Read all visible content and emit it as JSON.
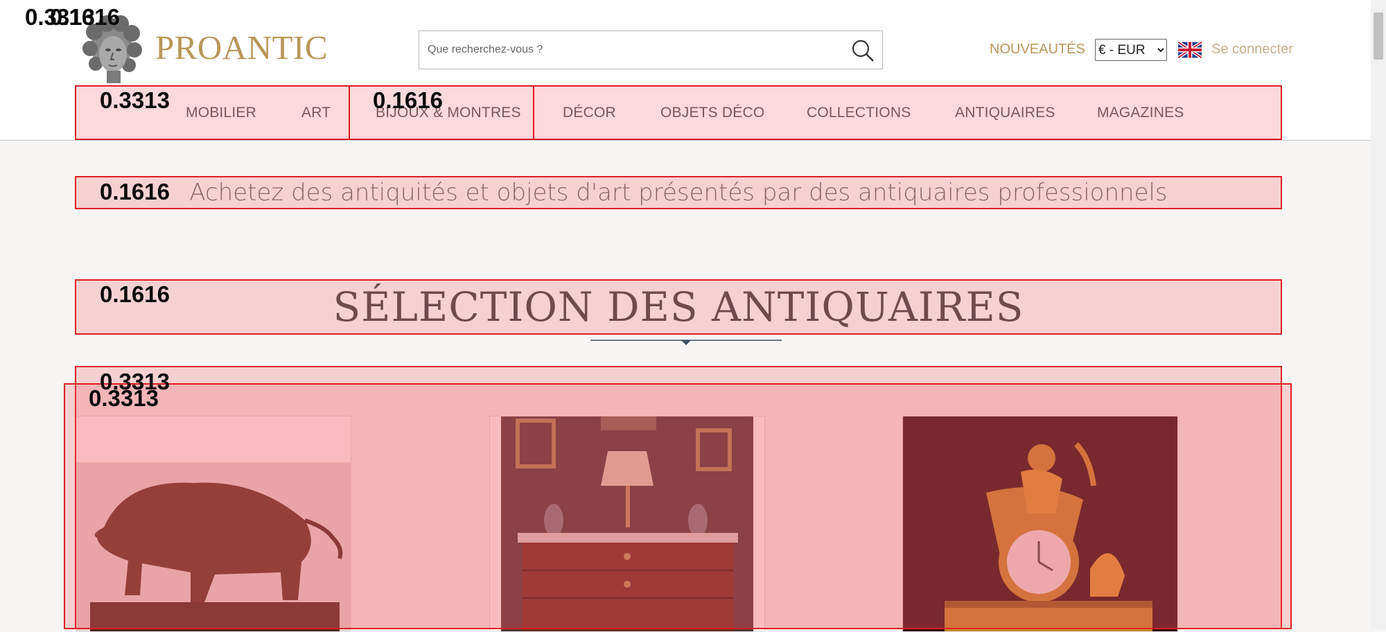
{
  "header": {
    "brand": "PROANTIC",
    "search": {
      "placeholder": "Que recherchez-vous ?",
      "value": ""
    },
    "nouveautes_label": "NOUVEAUTÉS",
    "currency": {
      "selected": "€ - EUR",
      "options": [
        "€ - EUR"
      ]
    },
    "flag_icon": "uk-flag-icon",
    "login_label": "Se connecter"
  },
  "nav": {
    "items": [
      {
        "label": "MOBILIER"
      },
      {
        "label": "ART"
      },
      {
        "label": "BIJOUX & MONTRES"
      },
      {
        "label": "DÉCOR"
      },
      {
        "label": "OBJETS DÉCO"
      },
      {
        "label": "COLLECTIONS"
      },
      {
        "label": "ANTIQUAIRES"
      },
      {
        "label": "MAGAZINES"
      }
    ]
  },
  "tagline": "Achetez des antiquités et objets d'art présentés par des antiquaires professionnels",
  "section": {
    "title": "SÉLECTION DES ANTIQUAIRES"
  },
  "products": [
    {
      "image": "bronze-boar-sculpture"
    },
    {
      "image": "antique-commode-with-lamp"
    },
    {
      "image": "gilt-bronze-mantel-clock"
    }
  ],
  "overlays": {
    "corner_label_a": "0.3313",
    "corner_label_b": "0.1616",
    "nav_left_label": "0.3313",
    "nav_mid_label": "0.1616",
    "tagline_label": "0.1616",
    "title_label": "0.1616",
    "products_outer_label": "0.3313",
    "products_inner_label": "0.3313"
  },
  "colors": {
    "brand_gold": "#b99658",
    "overlay_red": "#e01c24"
  }
}
